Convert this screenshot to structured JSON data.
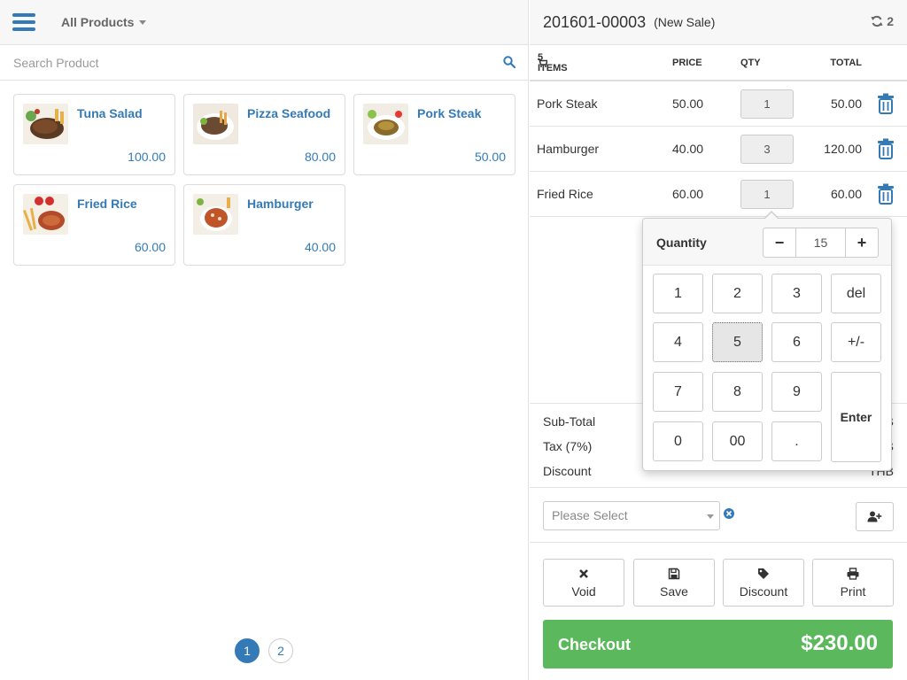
{
  "left": {
    "category_label": "All Products",
    "search_placeholder": "Search Product",
    "products": [
      {
        "name": "Tuna Salad",
        "price": "100.00"
      },
      {
        "name": "Pizza Seafood",
        "price": "80.00"
      },
      {
        "name": "Pork Steak",
        "price": "50.00"
      },
      {
        "name": "Fried Rice",
        "price": "60.00"
      },
      {
        "name": "Hamburger",
        "price": "40.00"
      }
    ],
    "pages": [
      "1",
      "2"
    ],
    "active_page": "1"
  },
  "sale": {
    "number": "201601-00003",
    "status": "(New Sale)",
    "sync_count": "2",
    "columns": {
      "items": "5 ITEMS",
      "price": "PRICE",
      "qty": "QTY",
      "total": "TOTAL"
    },
    "items": [
      {
        "name": "Pork Steak",
        "price": "50.00",
        "qty": "1",
        "total": "50.00"
      },
      {
        "name": "Hamburger",
        "price": "40.00",
        "qty": "3",
        "total": "120.00"
      },
      {
        "name": "Fried Rice",
        "price": "60.00",
        "qty": "1",
        "total": "60.00"
      }
    ],
    "summary": [
      {
        "label": "Sub-Total",
        "value": "B"
      },
      {
        "label": "Tax (7%)",
        "value": "B"
      },
      {
        "label": "Discount",
        "value": "THB"
      }
    ],
    "customer_placeholder": "Please Select",
    "actions": {
      "void": "Void",
      "save": "Save",
      "discount": "Discount",
      "print": "Print"
    },
    "checkout_label": "Checkout",
    "checkout_total": "$230.00"
  },
  "popover": {
    "title": "Quantity",
    "value": "15",
    "minus": "−",
    "plus": "+",
    "keys": [
      "1",
      "2",
      "3",
      "del",
      "4",
      "5",
      "6",
      "+/-",
      "7",
      "8",
      "9",
      "0",
      "00",
      "."
    ],
    "enter": "Enter",
    "pressed_key": "5"
  },
  "colors": {
    "primary": "#337ab7",
    "success": "#5cb85c"
  }
}
